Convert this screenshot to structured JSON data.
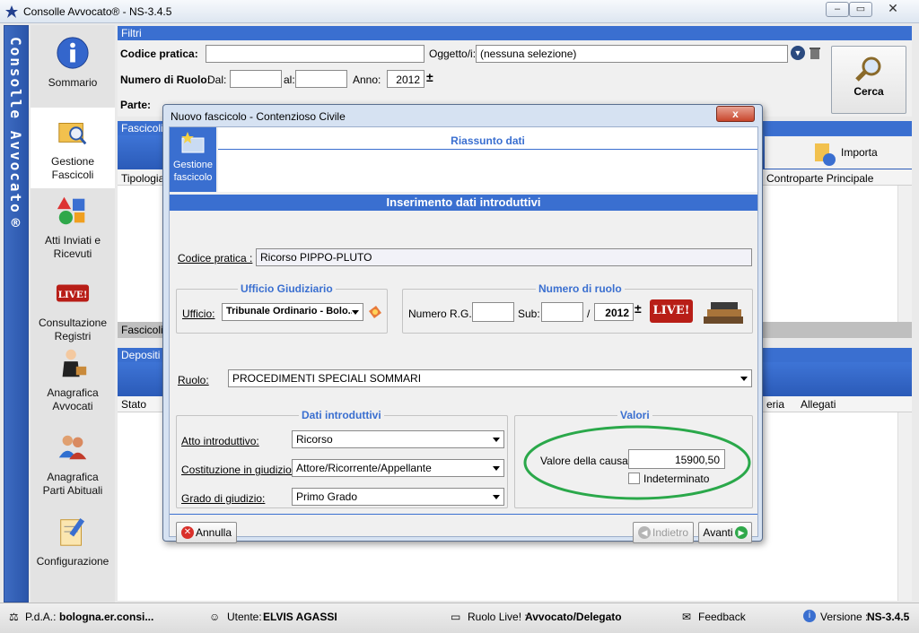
{
  "window": {
    "title": "Consolle Avvocato® - NS-3.4.5",
    "sidebar_banner": "Consolle Avvocato®"
  },
  "nav": [
    {
      "label": "Sommario",
      "icon": "info-icon"
    },
    {
      "label": "Gestione Fascicoli",
      "icon": "folder-search-icon"
    },
    {
      "label": "Atti Inviati e Ricevuti",
      "icon": "shapes-icon"
    },
    {
      "label": "Consultazione Registri",
      "icon": "live-badge-icon"
    },
    {
      "label": "Anagrafica Avvocati",
      "icon": "lawyer-icon"
    },
    {
      "label": "Anagrafica Parti Abituali",
      "icon": "people-icon"
    },
    {
      "label": "Configurazione",
      "icon": "settings-icon"
    }
  ],
  "filters": {
    "header": "Filtri",
    "codice_label": "Codice pratica:",
    "codice_value": "",
    "oggetto_label": "Oggetto/i:",
    "oggetto_value": "(nessuna selezione)",
    "ruolo_label": "Numero di Ruolo:",
    "dal_label": "Dal:",
    "al_label": "al:",
    "anno_label": "Anno:",
    "anno_value": "2012",
    "parte_label": "Parte:",
    "cerca_label": "Cerca"
  },
  "fascicoli": {
    "header": "Fascicoli",
    "col_tipologia": "Tipologia",
    "col_controparte": "Controparte Principale",
    "importa_label": "Importa",
    "footer": "Fascicoli"
  },
  "depositi": {
    "header": "Depositi",
    "col_stato": "Stato",
    "col_materia": "eria",
    "col_allegati": "Allegati"
  },
  "dialog": {
    "title": "Nuovo fascicolo - Contenzioso Civile",
    "close_label": "x",
    "side_label": "Gestione fascicolo",
    "riassunto": "Riassunto dati",
    "section_title": "Inserimento dati introduttivi",
    "codice_label": "Codice pratica :",
    "codice_value": "Ricorso PIPPO-PLUTO",
    "ufficio_group": "Ufficio Giudiziario",
    "ufficio_label": "Ufficio:",
    "ufficio_value": "Tribunale Ordinario - Bolo...",
    "numero_group": "Numero di ruolo",
    "numero_rg_label": "Numero R.G.:",
    "sub_label": "Sub:",
    "slash": "/",
    "anno_value": "2012",
    "live_label": "LIVE!",
    "ruolo_label": "Ruolo:",
    "ruolo_value": "PROCEDIMENTI SPECIALI SOMMARI",
    "dati_group": "Dati introduttivi",
    "atto_label": "Atto introduttivo:",
    "atto_value": "Ricorso",
    "costituzione_label": "Costituzione in giudizio:",
    "costituzione_value": "Attore/Ricorrente/Appellante",
    "grado_label": "Grado di giudizio:",
    "grado_value": "Primo Grado",
    "valori_group": "Valori",
    "valore_label": "Valore della causa:",
    "valore_value": "15900,50",
    "indeterminato_label": "Indeterminato",
    "annulla_label": "Annulla",
    "indietro_label": "Indietro",
    "avanti_label": "Avanti"
  },
  "status": {
    "pda_label": "P.d.A.:",
    "pda_value": "bologna.er.consi...",
    "utente_label": "Utente:",
    "utente_value": "ELVIS AGASSI",
    "ruolo_live_label": "Ruolo Live! :",
    "ruolo_live_value": "Avvocato/Delegato",
    "feedback_label": "Feedback",
    "versione_label": "Versione :",
    "versione_value": "NS-3.4.5"
  },
  "colors": {
    "accent": "#3a6fd0",
    "highlight_ellipse": "#2aa84a",
    "live_red": "#c0231a"
  }
}
